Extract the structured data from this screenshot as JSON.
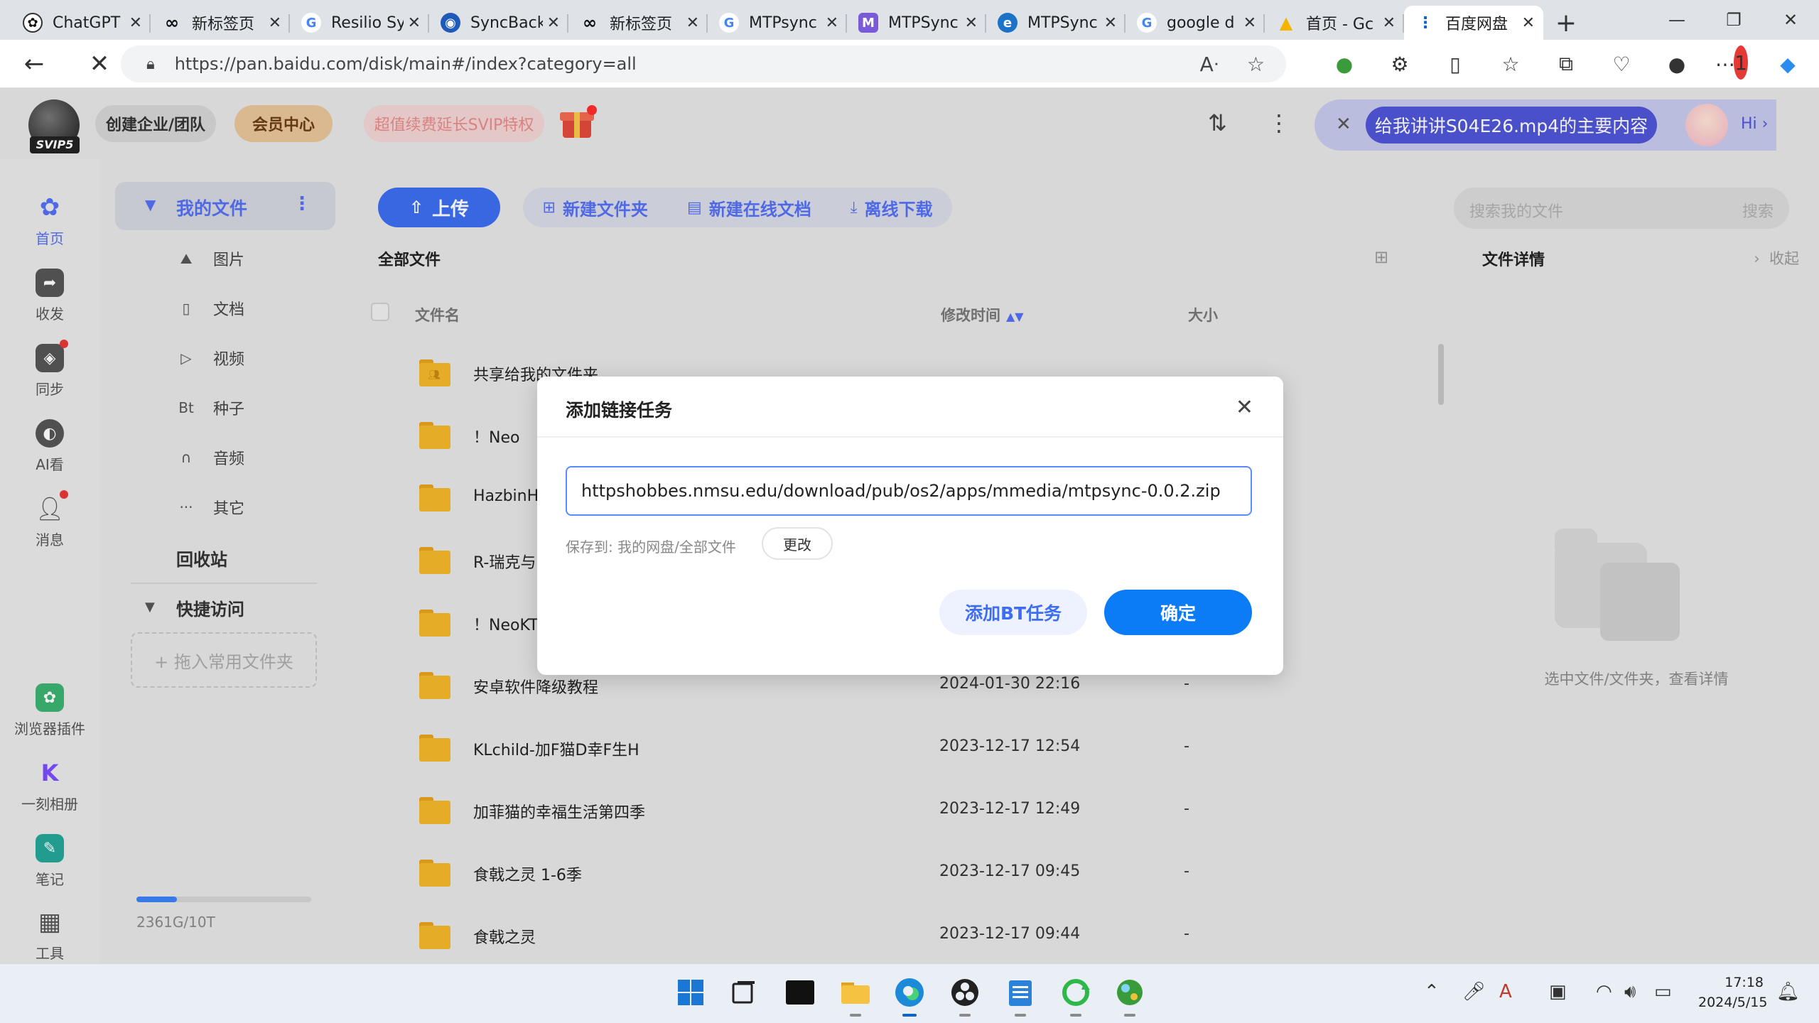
{
  "browser": {
    "tabs": [
      {
        "label": "ChatGPT",
        "icon": "chatgpt-icon"
      },
      {
        "label": "新标签页",
        "icon": "infinity-icon"
      },
      {
        "label": "Resilio Sy",
        "icon": "google-icon"
      },
      {
        "label": "SyncBack",
        "icon": "syncback-icon"
      },
      {
        "label": "新标签页",
        "icon": "infinity-icon"
      },
      {
        "label": "MTPsync",
        "icon": "google-icon"
      },
      {
        "label": "MTPSync",
        "icon": "mtpsync-icon"
      },
      {
        "label": "MTPSync",
        "icon": "edge-icon"
      },
      {
        "label": "google d",
        "icon": "google-icon"
      },
      {
        "label": "首页 - Gc",
        "icon": "google-drive-icon"
      },
      {
        "label": "百度网盘",
        "icon": "baidu-netdisk-icon",
        "active": true
      }
    ],
    "url": "https://pan.baidu.com/disk/main#/index?category=all"
  },
  "app_top": {
    "svip_level": "SVIP5",
    "team_label": "创建企业/团队",
    "vip_center_label": "会员中心",
    "svip_promo_label": "超值续费延长SVIP特权",
    "ai_prompt": "给我讲讲S04E26.mp4的主要内容",
    "ai_hi": "Hi ›"
  },
  "rail": {
    "items": [
      {
        "label": "首页",
        "icon": "home-icon",
        "color": "#5470f5"
      },
      {
        "label": "收发",
        "icon": "share-icon",
        "color": "#555555"
      },
      {
        "label": "同步",
        "icon": "sync-icon",
        "color": "#555555"
      },
      {
        "label": "AI看",
        "icon": "ai-icon",
        "color": "#555555"
      },
      {
        "label": "消息",
        "icon": "message-icon",
        "color": "#555555"
      },
      {
        "label": "浏览器插件",
        "icon": "plugin-icon",
        "color": "#3cb371"
      },
      {
        "label": "一刻相册",
        "icon": "album-icon",
        "color": "#7c4dff"
      },
      {
        "label": "笔记",
        "icon": "note-icon",
        "color": "#26a69a"
      },
      {
        "label": "工具",
        "icon": "tools-icon",
        "color": "#555555"
      }
    ]
  },
  "filenav": {
    "my_files": "我的文件",
    "categories": [
      {
        "label": "图片",
        "icon": "image-icon"
      },
      {
        "label": "文档",
        "icon": "document-icon"
      },
      {
        "label": "视频",
        "icon": "video-icon"
      },
      {
        "label": "种子",
        "icon": "bt-icon",
        "glyph": "Bt"
      },
      {
        "label": "音频",
        "icon": "headphone-icon"
      },
      {
        "label": "其它",
        "icon": "more-icon"
      }
    ],
    "recycle": "回收站",
    "quick_access": "快捷访问",
    "drop_hint": "+ 拖入常用文件夹",
    "storage_text": "2361G/10T",
    "storage_used_fraction": 0.23
  },
  "toolbar": {
    "upload": "上传",
    "new_folder": "新建文件夹",
    "new_doc": "新建在线文档",
    "offline_download": "离线下载"
  },
  "files": {
    "section_title": "全部文件",
    "columns": {
      "name": "文件名",
      "modified": "修改时间",
      "size": "大小"
    },
    "rows": [
      {
        "name": "共享给我的文件夹",
        "date": "",
        "size": ""
      },
      {
        "name": "！Neo",
        "date": "",
        "size": ""
      },
      {
        "name": "HazbinHo",
        "date": "",
        "size": ""
      },
      {
        "name": "R-瑞克与",
        "date": "",
        "size": ""
      },
      {
        "name": "！NeoKT",
        "date": "",
        "size": ""
      },
      {
        "name": "安卓软件降级教程",
        "date": "2024-01-30 22:16",
        "size": "-"
      },
      {
        "name": "KLchild-加F猫D幸F生H",
        "date": "2023-12-17 12:54",
        "size": "-"
      },
      {
        "name": "加菲猫的幸福生活第四季",
        "date": "2023-12-17 12:49",
        "size": "-"
      },
      {
        "name": "食戟之灵 1-6季",
        "date": "2023-12-17 09:45",
        "size": "-"
      },
      {
        "name": "食戟之灵",
        "date": "2023-12-17 09:44",
        "size": "-"
      }
    ]
  },
  "detail": {
    "search_placeholder": "搜索我的文件",
    "search_button": "搜索",
    "title": "文件详情",
    "collapse": "收起",
    "empty_hint": "选中文件/文件夹，查看详情"
  },
  "modal": {
    "title": "添加链接任务",
    "url_value": "httpshobbes.nmsu.edu/download/pub/os2/apps/mmedia/mtpsync-0.0.2.zip",
    "save_to_label": "保存到:",
    "save_to_path": "我的网盘/全部文件",
    "change_label": "更改",
    "bt_label": "添加BT任务",
    "ok_label": "确定"
  },
  "taskbar": {
    "time": "17:18",
    "date": "2024/5/15"
  }
}
